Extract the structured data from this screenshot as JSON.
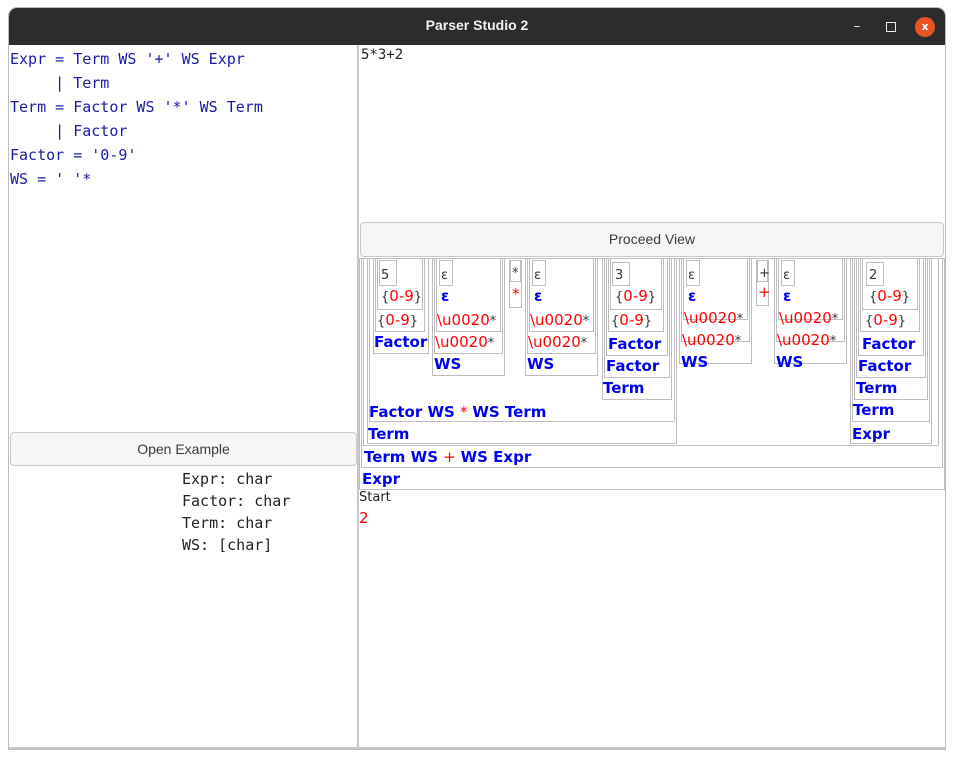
{
  "window": {
    "title": "Parser Studio 2",
    "controls": {
      "minimize": "–",
      "close": "x"
    }
  },
  "grammar": {
    "lines": [
      "Expr = Term WS '+' WS Expr",
      "     | Term",
      "Term = Factor WS '*' WS Term",
      "     | Factor",
      "Factor = '0-9'",
      "WS = ' '*"
    ]
  },
  "buttons": {
    "open_example": "Open Example",
    "proceed_view": "Proceed View"
  },
  "types": {
    "lines": [
      "Expr: char",
      "Factor: char",
      "Term: char",
      "WS: [char]"
    ]
  },
  "input": {
    "text": "5*3+2"
  },
  "tree": {
    "digits": [
      "5",
      "3",
      "2"
    ],
    "range_open": "{",
    "range": "0-9",
    "range_close": "}",
    "epsilon": "ε",
    "space_rep": "\\u0020",
    "star": "*",
    "plus": "+",
    "nt_factor": "Factor",
    "nt_ws": "WS",
    "nt_term": "Term",
    "nt_expr": "Expr",
    "seq_term_parts": [
      "Factor",
      "WS",
      "*",
      "WS",
      "Term"
    ],
    "seq_expr_parts": [
      "Term",
      "WS",
      "+",
      "WS",
      "Expr"
    ]
  },
  "status": {
    "label": "Start",
    "value": "2"
  }
}
